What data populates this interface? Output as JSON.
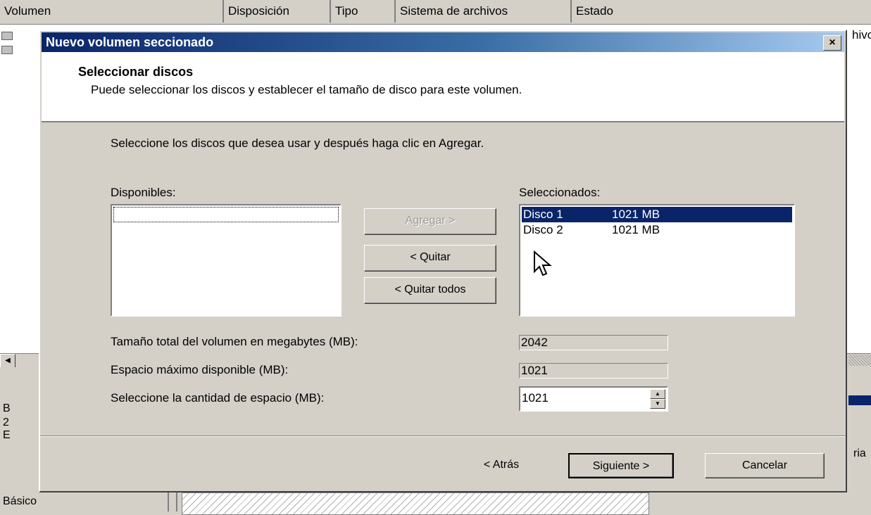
{
  "background": {
    "columns": [
      "Volumen",
      "Disposición",
      "Tipo",
      "Sistema de archivos",
      "Estado"
    ],
    "right_edge_text": "hivo",
    "right_edge_text2": "ria",
    "disk_label": "Básico",
    "lower_left_fragments": [
      "B",
      "2",
      "E"
    ]
  },
  "dialog": {
    "title": "Nuevo volumen seccionado",
    "close_label": "×",
    "header_title": "Seleccionar discos",
    "header_subtitle": "Puede seleccionar los discos y establecer el tamaño de disco para este volumen.",
    "instruction": "Seleccione los discos que desea usar  y después haga clic en Agregar.",
    "available_label": "Disponibles:",
    "selected_label": "Seleccionados:",
    "add_button": "Agregar >",
    "remove_button": "< Quitar",
    "remove_all_button": "< Quitar todos",
    "selected_disks": [
      {
        "name": "Disco 1",
        "size": "1021 MB",
        "selected": true
      },
      {
        "name": "Disco 2",
        "size": "1021 MB",
        "selected": false
      }
    ],
    "total_size_label": "Tamaño total del volumen en megabytes (MB):",
    "total_size_value": "2042",
    "max_space_label": "Espacio máximo disponible (MB):",
    "max_space_value": "1021",
    "amount_label": "Seleccione la cantidad de espacio (MB):",
    "amount_value": "1021",
    "back_button": "< Atrás",
    "next_button": "Siguiente >",
    "cancel_button": "Cancelar"
  }
}
